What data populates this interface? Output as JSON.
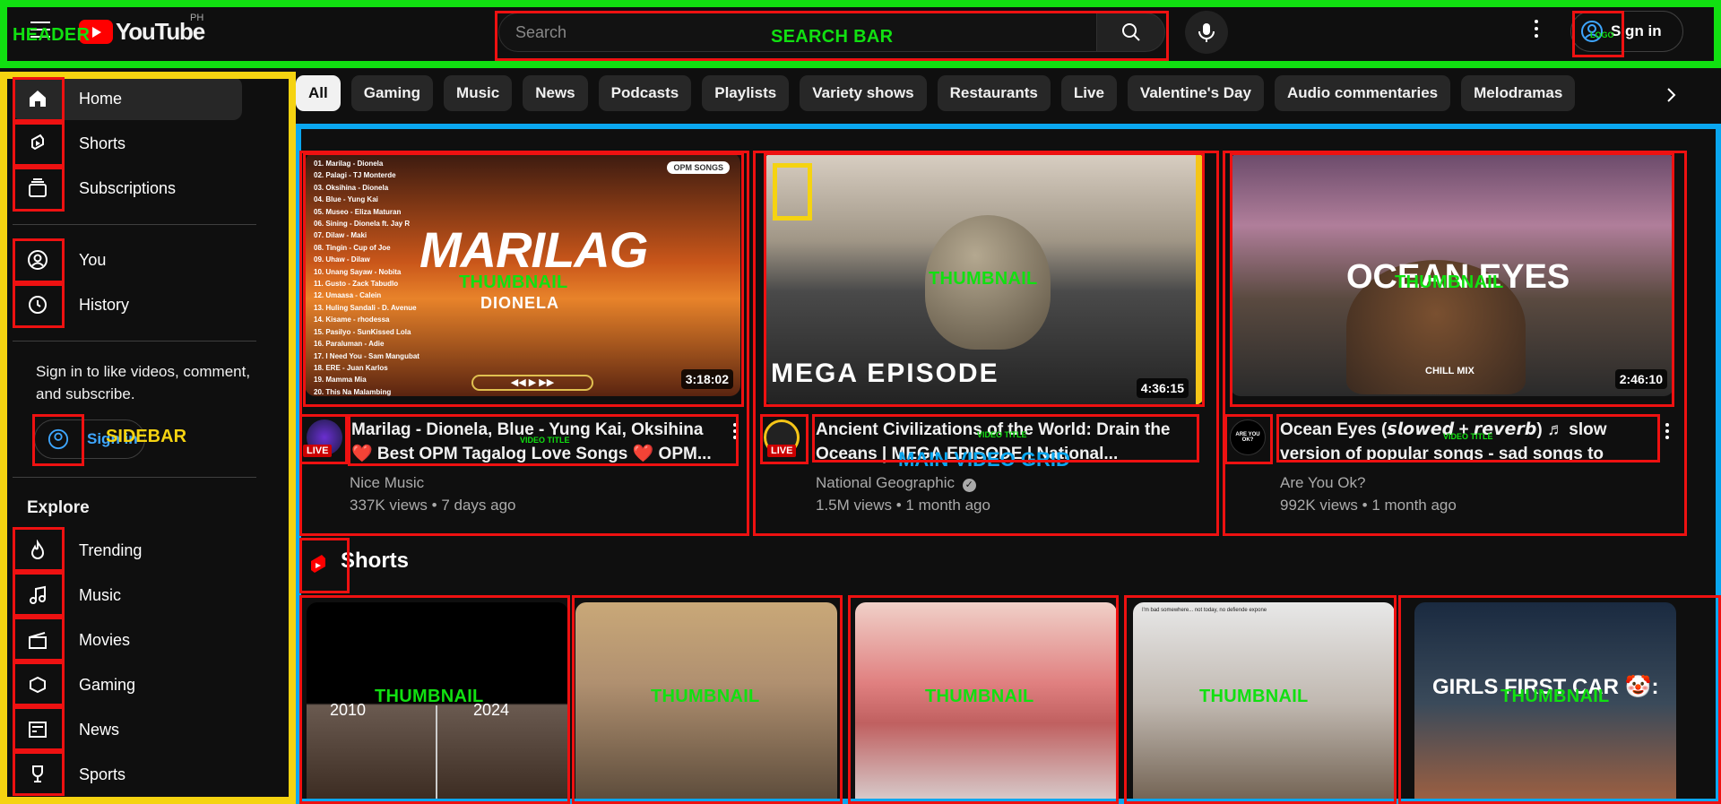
{
  "header": {
    "logo_text": "YouTube",
    "country_code": "PH",
    "search_placeholder": "Search",
    "signin_label": "Sign in"
  },
  "sidebar": {
    "items_main": [
      {
        "label": "Home",
        "icon": "home-icon"
      },
      {
        "label": "Shorts",
        "icon": "shorts-icon"
      },
      {
        "label": "Subscriptions",
        "icon": "subscriptions-icon"
      }
    ],
    "items_you": [
      {
        "label": "You",
        "icon": "user-icon"
      },
      {
        "label": "History",
        "icon": "history-icon"
      }
    ],
    "signin_note": "Sign in to like videos, comment, and subscribe.",
    "signin_label": "Sign in",
    "explore_heading": "Explore",
    "items_explore": [
      {
        "label": "Trending",
        "icon": "trending-icon"
      },
      {
        "label": "Music",
        "icon": "music-icon"
      },
      {
        "label": "Movies",
        "icon": "movies-icon"
      },
      {
        "label": "Gaming",
        "icon": "gaming-icon"
      },
      {
        "label": "News",
        "icon": "news-icon"
      },
      {
        "label": "Sports",
        "icon": "sports-icon"
      }
    ]
  },
  "chips": [
    "All",
    "Gaming",
    "Music",
    "News",
    "Podcasts",
    "Playlists",
    "Variety shows",
    "Restaurants",
    "Live",
    "Valentine's Day",
    "Audio commentaries",
    "Melodramas"
  ],
  "videos": [
    {
      "title": "Marilag - Dionela, Blue - Yung Kai, Oksihina ❤️ Best OPM Tagalog Love Songs ❤️ OPM...",
      "channel": "Nice Music",
      "meta": "337K views • 7 days ago",
      "duration": "3:18:02",
      "thumb_text": "MARILAG",
      "thumb_sub": "DIONELA",
      "thumb_badge": "OPM SONGS",
      "live": "LIVE",
      "track_list": [
        "01. Marilag - Dionela",
        "02. Palagi - TJ Monterde",
        "03. Oksihina - Dionela",
        "04. Blue - Yung Kai",
        "05. Museo - Eliza Maturan",
        "06. Sining - Dionela ft. Jay R",
        "07. Dilaw - Maki",
        "08. Tingin - Cup of Joe",
        "09. Uhaw - Dilaw",
        "10. Unang Sayaw - Nobita",
        "11. Gusto - Zack Tabudlo",
        "12. Umaasa - Calein",
        "13. Huling Sandali - D. Avenue",
        "14. Kisame - rhodessa",
        "15. Pasilyo - SunKissed Lola",
        "16. Paraluman - Adie",
        "17. I Need You - Sam Mangubat",
        "18. ERE - Juan Karlos",
        "19. Mamma Mia",
        "20. This Na Malambing"
      ]
    },
    {
      "title": "Ancient Civilizations of the World: Drain the Oceans | MEGA EPISODE | National...",
      "channel": "National Geographic",
      "meta": "1.5M views • 1 month ago",
      "duration": "4:36:15",
      "thumb_text": "MEGA EPISODE",
      "live": "LIVE",
      "verified": "✓"
    },
    {
      "title": "Ocean Eyes (𝙨𝙡𝙤𝙬𝙚𝙙 + 𝙧𝙚𝙫𝙚𝙧𝙗) ♬ slow version of popular songs - sad songs to liste...",
      "channel": "Are You Ok?",
      "meta": "992K views • 1 month ago",
      "duration": "2:46:10",
      "thumb_text": "OCEAN EYES",
      "thumb_sub": "CHILL MIX",
      "avatar_text": "ARE YOU OK?"
    }
  ],
  "shorts": {
    "heading": "Shorts",
    "items": [
      {
        "caption_a": "2010",
        "caption_b": "2024"
      },
      {
        "caption": ""
      },
      {
        "caption": ""
      },
      {
        "caption": "I'm bad somewhere... not today, no defiende expone"
      },
      {
        "caption": "GIRLS FIRST CAR 🤡:"
      }
    ]
  },
  "annotations": {
    "header": "HEADER",
    "search_bar": "SEARCH BAR",
    "sidebar": "SIDEBAR",
    "main_grid": "MAIN VIDEO GRID",
    "thumbnail": "THUMBNAIL",
    "video_title": "VIDEO TITLE",
    "logo": "LOGO"
  },
  "colors": {
    "background": "#0f0f0f",
    "accent_red": "#ff0000",
    "link_blue": "#3ea6ff",
    "ann_green": "#11e011",
    "ann_yellow": "#f5d311",
    "ann_blue": "#0aa7f0",
    "ann_red": "#ee1111"
  }
}
